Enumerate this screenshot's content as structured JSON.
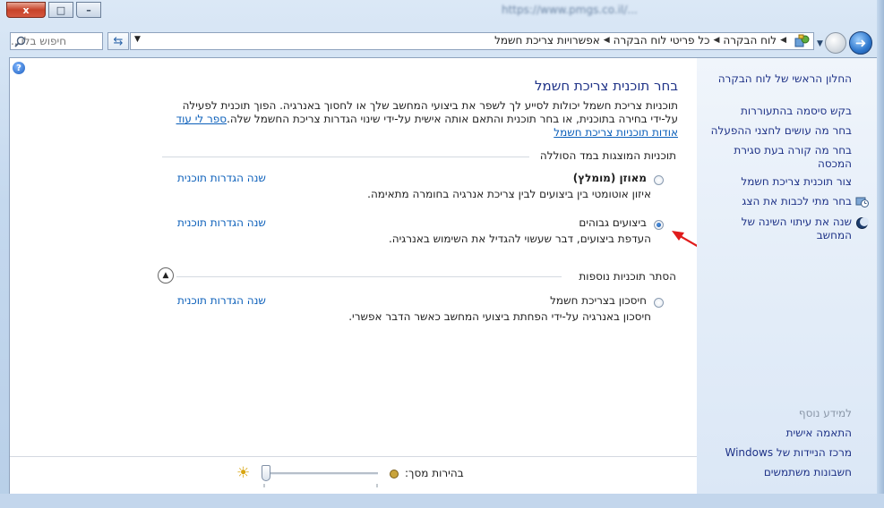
{
  "titlebar": {
    "url_blurred": "https://www.pmgs.co.il/...",
    "close_label": "x",
    "max_label": "□",
    "min_label": "–"
  },
  "toolbar": {
    "search_placeholder": "חיפוש בלו...",
    "breadcrumbs": [
      "לוח הבקרה",
      "כל פריטי לוח הבקרה",
      "אפשרויות צריכת חשמל"
    ]
  },
  "main": {
    "title": "בחר תוכנית צריכת חשמל",
    "intro_text": "תוכניות צריכת חשמל יכולות לסייע לך לשפר את ביצועי המחשב שלך או לחסוך באנרגיה. הפוך תוכנית לפעילה על-ידי בחירה בתוכנית, או בחר תוכנית והתאם אותה אישית על-ידי שינוי הגדרות צריכת החשמל שלה.",
    "intro_link": "ספר לי עוד אודות תוכניות צריכת חשמל",
    "section_shown": "תוכניות המוצגות במד הסוללה",
    "section_more": "הסתר תוכניות נוספות",
    "plans": [
      {
        "name": "מאוזן (מומלץ)",
        "desc": "איזון אוטומטי בין ביצועים לבין צריכת אנרגיה בחומרה מתאימה.",
        "change": "שנה הגדרות תוכנית",
        "selected": false
      },
      {
        "name": "ביצועים גבוהים",
        "desc": "העדפת ביצועים, דבר שעשוי להגדיל את השימוש באנרגיה.",
        "change": "שנה הגדרות תוכנית",
        "selected": true
      },
      {
        "name": "חיסכון בצריכת חשמל",
        "desc": "חיסכון באנרגיה על-ידי הפחתת ביצועי המחשב כאשר הדבר אפשרי.",
        "change": "שנה הגדרות תוכנית",
        "selected": false
      }
    ],
    "brightness_label": "בהירות מסך:",
    "brightness_level": 0.0
  },
  "sidebar": {
    "home": "החלון הראשי של לוח הבקרה",
    "links": [
      "בקש סיסמה בהתעוררות",
      "בחר מה עושים לחצני ההפעלה",
      "בחר מה קורה בעת סגירת המכסה",
      "צור תוכנית צריכת חשמל",
      "בחר מתי לכבות את הצג",
      "שנה את עיתוי השינה של המחשב"
    ],
    "see_also": "למידע נוסף",
    "see_also_links": [
      "התאמה אישית",
      "מרכז הניידות של Windows",
      "חשבונות משתמשים"
    ]
  },
  "colors": {
    "link": "#0b5fba",
    "title": "#1e3287",
    "annotation_arrow": "#e01b1b"
  }
}
